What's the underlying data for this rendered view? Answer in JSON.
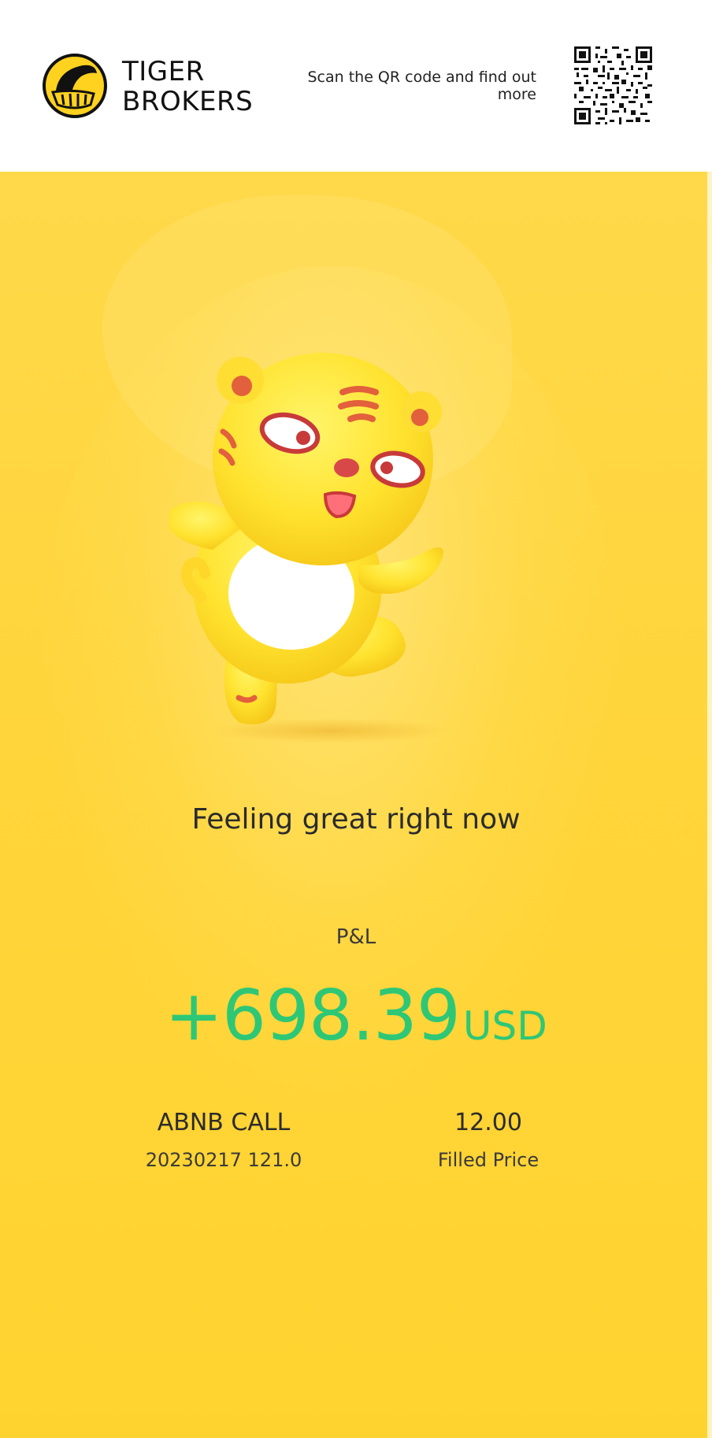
{
  "header": {
    "brand_name": "TIGER\nBROKERS",
    "scan_text": "Scan the QR code and find out more",
    "logo_icon": "tiger-brokers-logo",
    "qr_icon": "qr-code"
  },
  "card": {
    "mascot_icon": "tiger-mascot",
    "mood_text": "Feeling great right now",
    "pnl_label": "P&L",
    "pnl_amount": "+698.39",
    "pnl_unit": "USD",
    "instrument_name": "ABNB CALL",
    "instrument_detail": "20230217 121.0",
    "price_value": "12.00",
    "price_label": "Filled Price"
  },
  "colors": {
    "background_yellow": "#ffd53c",
    "profit_green": "#2dc776",
    "text_dark": "#2b2b2b"
  }
}
